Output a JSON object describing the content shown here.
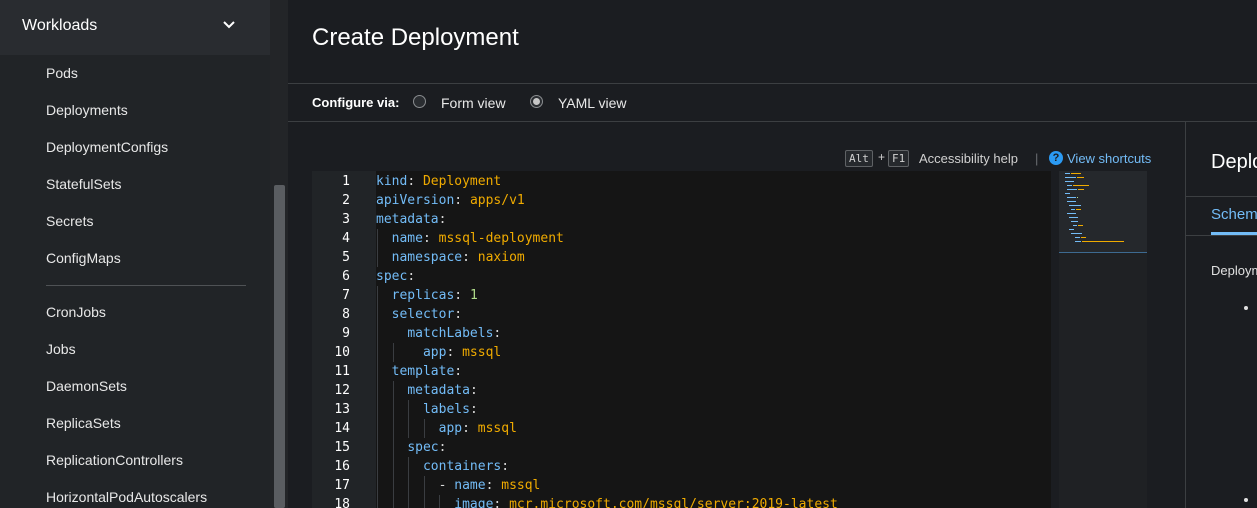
{
  "sidebar": {
    "section_label": "Workloads",
    "items": [
      {
        "label": "Pods"
      },
      {
        "label": "Deployments"
      },
      {
        "label": "DeploymentConfigs"
      },
      {
        "label": "StatefulSets"
      },
      {
        "label": "Secrets"
      },
      {
        "label": "ConfigMaps"
      },
      {
        "label": "CronJobs"
      },
      {
        "label": "Jobs"
      },
      {
        "label": "DaemonSets"
      },
      {
        "label": "ReplicaSets"
      },
      {
        "label": "ReplicationControllers"
      },
      {
        "label": "HorizontalPodAutoscalers"
      }
    ]
  },
  "header": {
    "title": "Create Deployment"
  },
  "configure": {
    "label": "Configure via:",
    "options": [
      {
        "label": "Form view",
        "selected": false
      },
      {
        "label": "YAML view",
        "selected": true
      }
    ]
  },
  "editor_toolbar": {
    "key1": "Alt",
    "plus": "+",
    "key2": "F1",
    "accessibility_help": "Accessibility help",
    "separator": "|",
    "help_icon": "?",
    "view_shortcuts": "View shortcuts"
  },
  "editor": {
    "lines": [
      {
        "num": "1",
        "indent": "",
        "key": "kind",
        "value": "Deployment",
        "type": "str"
      },
      {
        "num": "2",
        "indent": "",
        "key": "apiVersion",
        "value": "apps/v1",
        "type": "str"
      },
      {
        "num": "3",
        "indent": "",
        "key": "metadata",
        "value": "",
        "type": "none"
      },
      {
        "num": "4",
        "indent": "  ",
        "key": "name",
        "value": "mssql-deployment",
        "type": "str"
      },
      {
        "num": "5",
        "indent": "  ",
        "key": "namespace",
        "value": "naxiom",
        "type": "str"
      },
      {
        "num": "6",
        "indent": "",
        "key": "spec",
        "value": "",
        "type": "none"
      },
      {
        "num": "7",
        "indent": "  ",
        "key": "replicas",
        "value": "1",
        "type": "num"
      },
      {
        "num": "8",
        "indent": "  ",
        "key": "selector",
        "value": "",
        "type": "none"
      },
      {
        "num": "9",
        "indent": "    ",
        "key": "matchLabels",
        "value": "",
        "type": "none"
      },
      {
        "num": "10",
        "indent": "      ",
        "key": "app",
        "value": "mssql",
        "type": "str"
      },
      {
        "num": "11",
        "indent": "  ",
        "key": "template",
        "value": "",
        "type": "none"
      },
      {
        "num": "12",
        "indent": "    ",
        "key": "metadata",
        "value": "",
        "type": "none"
      },
      {
        "num": "13",
        "indent": "      ",
        "key": "labels",
        "value": "",
        "type": "none"
      },
      {
        "num": "14",
        "indent": "        ",
        "key": "app",
        "value": "mssql",
        "type": "str"
      },
      {
        "num": "15",
        "indent": "    ",
        "key": "spec",
        "value": "",
        "type": "none"
      },
      {
        "num": "16",
        "indent": "      ",
        "key": "containers",
        "value": "",
        "type": "none"
      },
      {
        "num": "17",
        "indent": "        - ",
        "key": "name",
        "value": "mssql",
        "type": "str"
      },
      {
        "num": "18",
        "indent": "          ",
        "key": "image",
        "value": "mcr.microsoft.com/mssql/server:2019-latest",
        "type": "str"
      }
    ]
  },
  "side_panel": {
    "title": "Deployment",
    "tab": "Schema",
    "description": "Deployment"
  },
  "colors": {
    "accent": "#73bcf7",
    "yaml_key": "#73bcf7",
    "yaml_string": "#f0ab00",
    "yaml_number": "#b0dc8a"
  }
}
